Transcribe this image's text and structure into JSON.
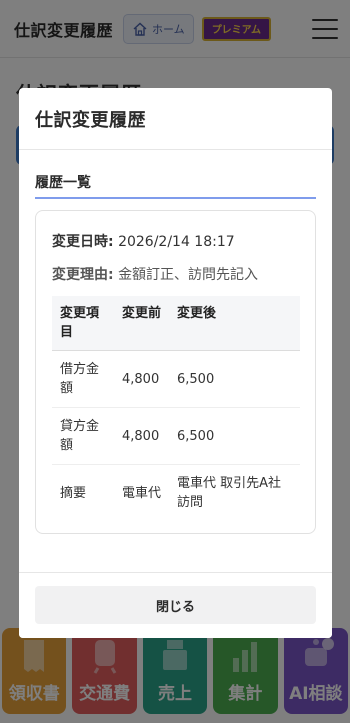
{
  "app": {
    "title": "仕訳変更履歴",
    "home_label": "ホーム",
    "premium_label": "プレミアム"
  },
  "background": {
    "page_title": "仕訳変更履歴"
  },
  "bottom_nav": [
    {
      "label": "領収書",
      "icon": "receipt-icon",
      "color": "#e9a23b"
    },
    {
      "label": "交通費",
      "icon": "train-icon",
      "color": "#e25e5e"
    },
    {
      "label": "売上",
      "icon": "register-icon",
      "color": "#2aa58a"
    },
    {
      "label": "集計",
      "icon": "bar-chart-icon",
      "color": "#4caf50"
    },
    {
      "label": "AI相談",
      "icon": "robot-icon",
      "color": "#7b57c9"
    }
  ],
  "modal": {
    "title": "仕訳変更履歴",
    "tab_label": "履歴一覧",
    "entry": {
      "date_key": "変更日時:",
      "date_value": "2026/2/14 18:17",
      "reason_key": "変更理由:",
      "reason_value": "金額訂正、訪問先記入"
    },
    "table": {
      "headers": [
        "変更項目",
        "変更前",
        "変更後"
      ],
      "rows": [
        [
          "借方金額",
          "4,800",
          "6,500"
        ],
        [
          "貸方金額",
          "4,800",
          "6,500"
        ],
        [
          "摘要",
          "電車代",
          "電車代 取引先A社訪問"
        ]
      ]
    },
    "close_label": "閉じる"
  }
}
